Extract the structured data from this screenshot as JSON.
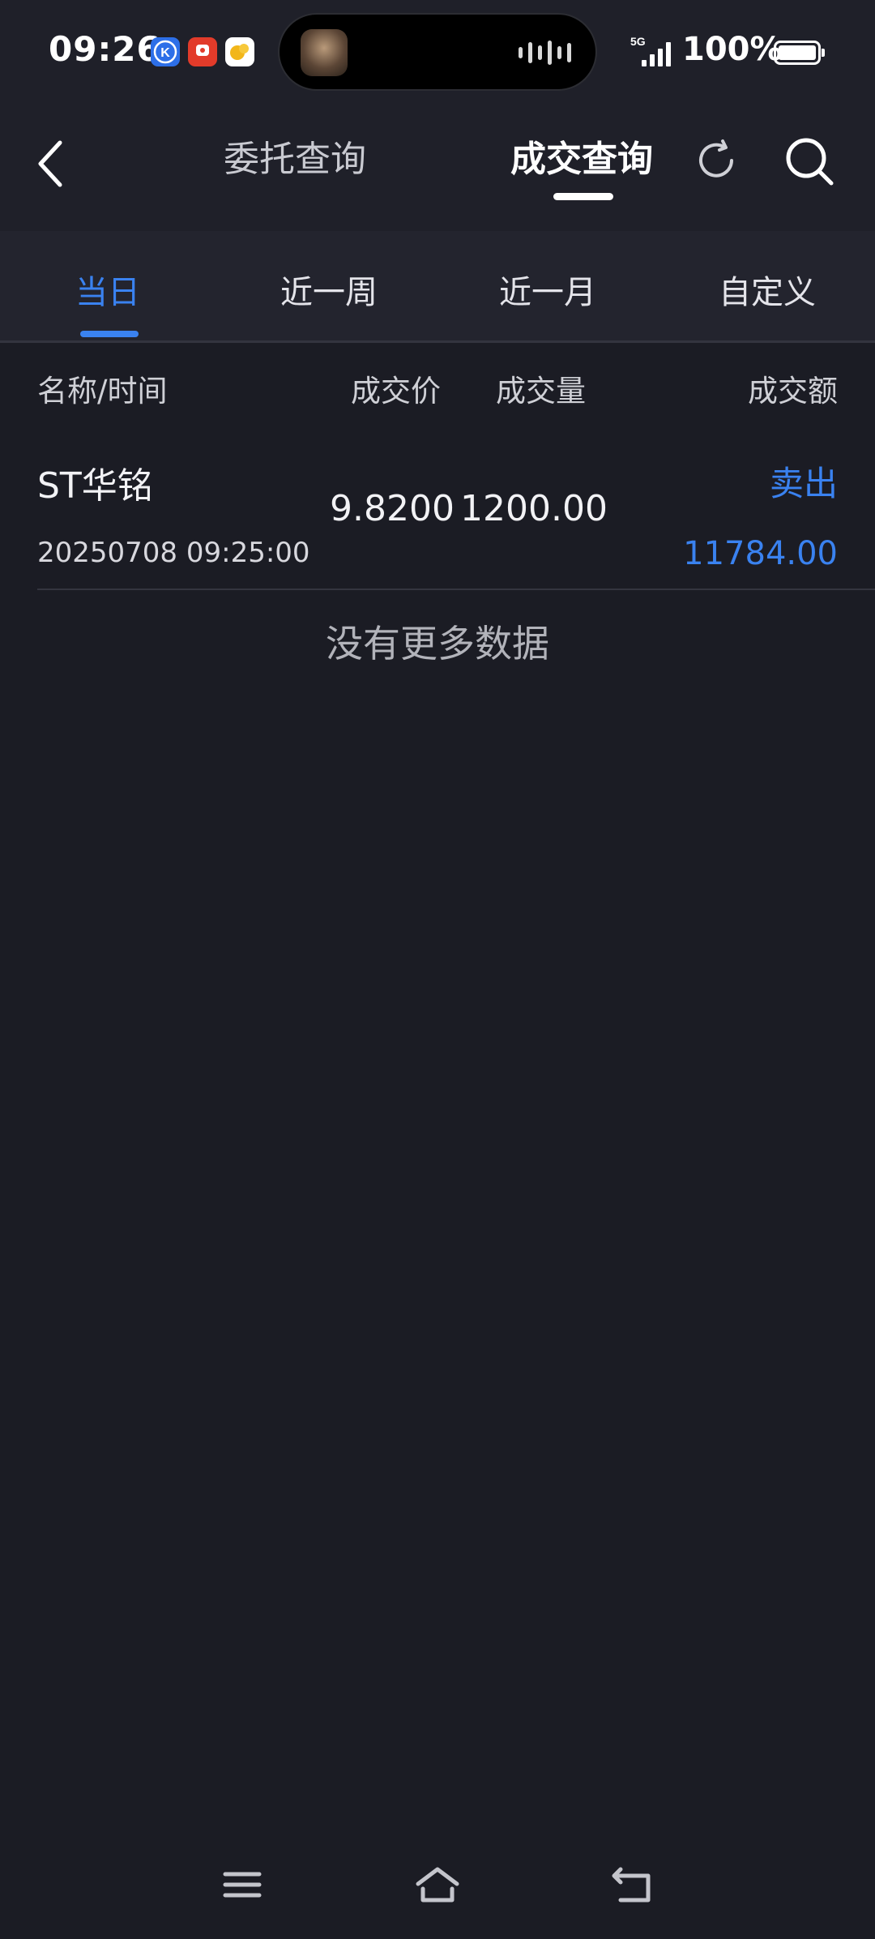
{
  "status_bar": {
    "time": "09:26",
    "network": "5G",
    "battery": "100%",
    "notification_icons": [
      "k-app-icon",
      "red-app-icon",
      "yellow-app-icon"
    ]
  },
  "header": {
    "tabs": [
      {
        "label": "委托查询",
        "active": false
      },
      {
        "label": "成交查询",
        "active": true
      }
    ],
    "icons": [
      "back-arrow-icon",
      "refresh-icon",
      "search-icon"
    ]
  },
  "range_tabs": [
    {
      "label": "当日",
      "active": true
    },
    {
      "label": "近一周",
      "active": false
    },
    {
      "label": "近一月",
      "active": false
    },
    {
      "label": "自定义",
      "active": false
    }
  ],
  "columns": {
    "name_time": "名称/时间",
    "price": "成交价",
    "volume": "成交量",
    "amount": "成交额"
  },
  "trades": [
    {
      "name": "ST华铭",
      "datetime": "20250708 09:25:00",
      "price": "9.8200",
      "volume": "1200.00",
      "direction": "卖出",
      "amount": "11784.00"
    }
  ],
  "footer_text": "没有更多数据",
  "colors": {
    "background": "#1b1c24",
    "accent_blue": "#3a82f0",
    "text_primary": "#f2f2f5"
  },
  "nav_icons": [
    "menu-icon",
    "home-icon",
    "back-icon"
  ]
}
